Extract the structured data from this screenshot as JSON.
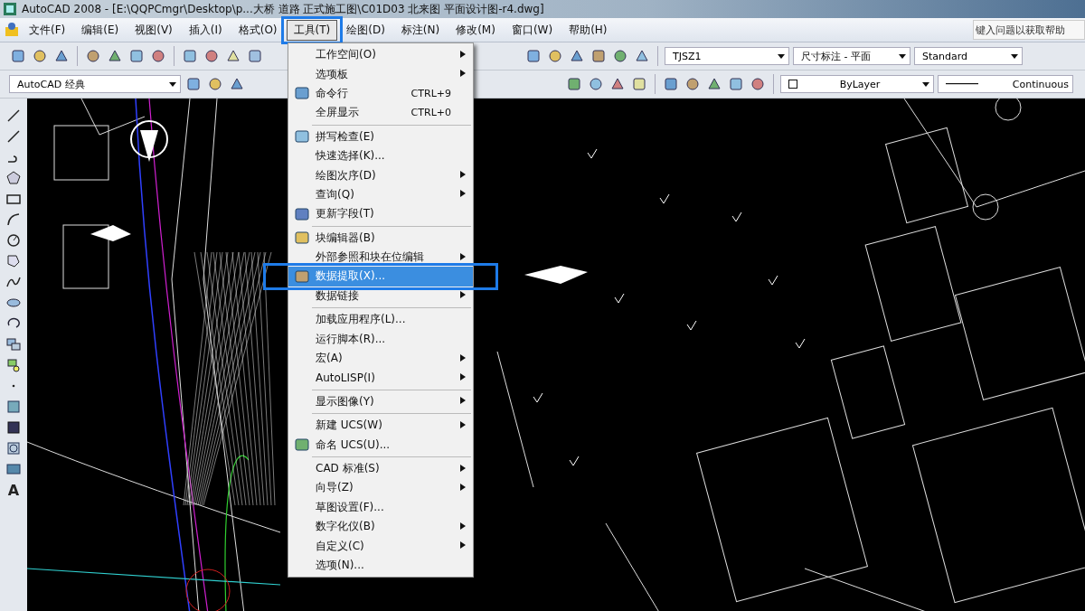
{
  "window": {
    "title": "AutoCAD 2008 - [E:\\QQPCmgr\\Desktop\\p...大桥 道路 正式施工图\\C01D03 北来图 平面设计图-r4.dwg]"
  },
  "menu_bar": {
    "items": [
      {
        "label": "文件(F)",
        "selected": false
      },
      {
        "label": "编辑(E)",
        "selected": false
      },
      {
        "label": "视图(V)",
        "selected": false
      },
      {
        "label": "插入(I)",
        "selected": false
      },
      {
        "label": "格式(O)",
        "selected": false
      },
      {
        "label": "工具(T)",
        "selected": true
      },
      {
        "label": "绘图(D)",
        "selected": false
      },
      {
        "label": "标注(N)",
        "selected": false
      },
      {
        "label": "修改(M)",
        "selected": false
      },
      {
        "label": "窗口(W)",
        "selected": false
      },
      {
        "label": "帮助(H)",
        "selected": false
      }
    ],
    "help_search": {
      "placeholder": "键入问题以获取帮助"
    }
  },
  "toolbar": {
    "text_style": "TJSZ1",
    "dim_style": "尺寸标注 - 平面",
    "table_style": "Standard"
  },
  "toolbar_2": {
    "workspace": "AutoCAD 经典",
    "color_dropdown": "ByLayer",
    "linetype": "Continuous"
  },
  "draw_toolbar": {
    "text_tool": "A"
  },
  "tools_menu": {
    "items": [
      {
        "kind": "item",
        "label": "工作空间(O)",
        "submenu": true,
        "icon": false,
        "selected": false
      },
      {
        "kind": "item",
        "label": "选项板",
        "submenu": true,
        "icon": false,
        "selected": false
      },
      {
        "kind": "item",
        "label": "命令行",
        "shortcut": "CTRL+9",
        "submenu": false,
        "icon": true,
        "selected": false
      },
      {
        "kind": "item",
        "label": "全屏显示",
        "shortcut": "CTRL+0",
        "submenu": false,
        "icon": false,
        "selected": false
      },
      {
        "kind": "separator"
      },
      {
        "kind": "item",
        "label": "拼写检查(E)",
        "submenu": false,
        "icon": true,
        "selected": false
      },
      {
        "kind": "item",
        "label": "快速选择(K)...",
        "submenu": false,
        "icon": false,
        "selected": false
      },
      {
        "kind": "item",
        "label": "绘图次序(D)",
        "submenu": true,
        "icon": false,
        "selected": false
      },
      {
        "kind": "item",
        "label": "查询(Q)",
        "submenu": true,
        "icon": false,
        "selected": false
      },
      {
        "kind": "item",
        "label": "更新字段(T)",
        "submenu": false,
        "icon": true,
        "selected": false
      },
      {
        "kind": "separator"
      },
      {
        "kind": "item",
        "label": "块编辑器(B)",
        "submenu": false,
        "icon": true,
        "selected": false
      },
      {
        "kind": "item",
        "label": "外部参照和块在位编辑",
        "submenu": true,
        "icon": false,
        "selected": false
      },
      {
        "kind": "item",
        "label": "数据提取(X)...",
        "submenu": false,
        "icon": true,
        "selected": true
      },
      {
        "kind": "item",
        "label": "数据链接",
        "submenu": true,
        "icon": false,
        "selected": false
      },
      {
        "kind": "separator"
      },
      {
        "kind": "item",
        "label": "加载应用程序(L)...",
        "submenu": false,
        "icon": false,
        "selected": false
      },
      {
        "kind": "item",
        "label": "运行脚本(R)...",
        "submenu": false,
        "icon": false,
        "selected": false
      },
      {
        "kind": "item",
        "label": "宏(A)",
        "submenu": true,
        "icon": false,
        "selected": false
      },
      {
        "kind": "item",
        "label": "AutoLISP(I)",
        "submenu": true,
        "icon": false,
        "selected": false
      },
      {
        "kind": "separator"
      },
      {
        "kind": "item",
        "label": "显示图像(Y)",
        "submenu": true,
        "icon": false,
        "selected": false
      },
      {
        "kind": "separator"
      },
      {
        "kind": "item",
        "label": "新建 UCS(W)",
        "submenu": true,
        "icon": false,
        "selected": false
      },
      {
        "kind": "item",
        "label": "命名 UCS(U)...",
        "submenu": false,
        "icon": true,
        "selected": false
      },
      {
        "kind": "separator"
      },
      {
        "kind": "item",
        "label": "CAD 标准(S)",
        "submenu": true,
        "icon": false,
        "selected": false
      },
      {
        "kind": "item",
        "label": "向导(Z)",
        "submenu": true,
        "icon": false,
        "selected": false
      },
      {
        "kind": "item",
        "label": "草图设置(F)...",
        "submenu": false,
        "icon": false,
        "selected": false
      },
      {
        "kind": "item",
        "label": "数字化仪(B)",
        "submenu": true,
        "icon": false,
        "selected": false
      },
      {
        "kind": "item",
        "label": "自定义(C)",
        "submenu": true,
        "icon": false,
        "selected": false
      },
      {
        "kind": "item",
        "label": "选项(N)...",
        "submenu": false,
        "icon": false,
        "selected": false
      }
    ]
  }
}
